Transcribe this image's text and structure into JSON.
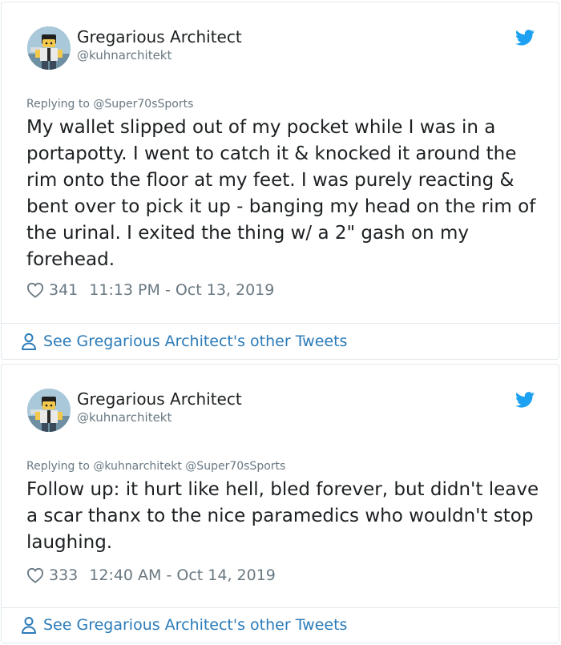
{
  "tweets": [
    {
      "author_name": "Gregarious Architect",
      "author_handle": "@kuhnarchitekt",
      "replying_to": "Replying to @Super70sSports",
      "text": "My wallet slipped out of my pocket while I was in a portapotty. I went to catch it & knocked it around the rim onto the floor at my feet. I was purely reacting & bent over to pick it up - banging my head on the rim of the urinal. I exited the thing w/ a 2\" gash on my forehead.",
      "likes": "341",
      "timestamp": "11:13 PM - Oct 13, 2019",
      "see_more": "See Gregarious Architect's other Tweets"
    },
    {
      "author_name": "Gregarious Architect",
      "author_handle": "@kuhnarchitekt",
      "replying_to": "Replying to @kuhnarchitekt @Super70sSports",
      "text": "Follow up: it hurt like hell, bled forever, but didn't leave a scar thanx to the nice paramedics who wouldn't stop laughing.",
      "likes": "333",
      "timestamp": "12:40 AM - Oct 14, 2019",
      "see_more": "See Gregarious Architect's other Tweets"
    }
  ],
  "colors": {
    "text": "#1c2022",
    "muted": "#697882",
    "link": "#2b7bb9",
    "twitter_blue": "#1da1f2",
    "border": "#e1e8ed"
  },
  "icons": [
    "twitter-bird-icon",
    "heart-icon",
    "person-icon"
  ]
}
